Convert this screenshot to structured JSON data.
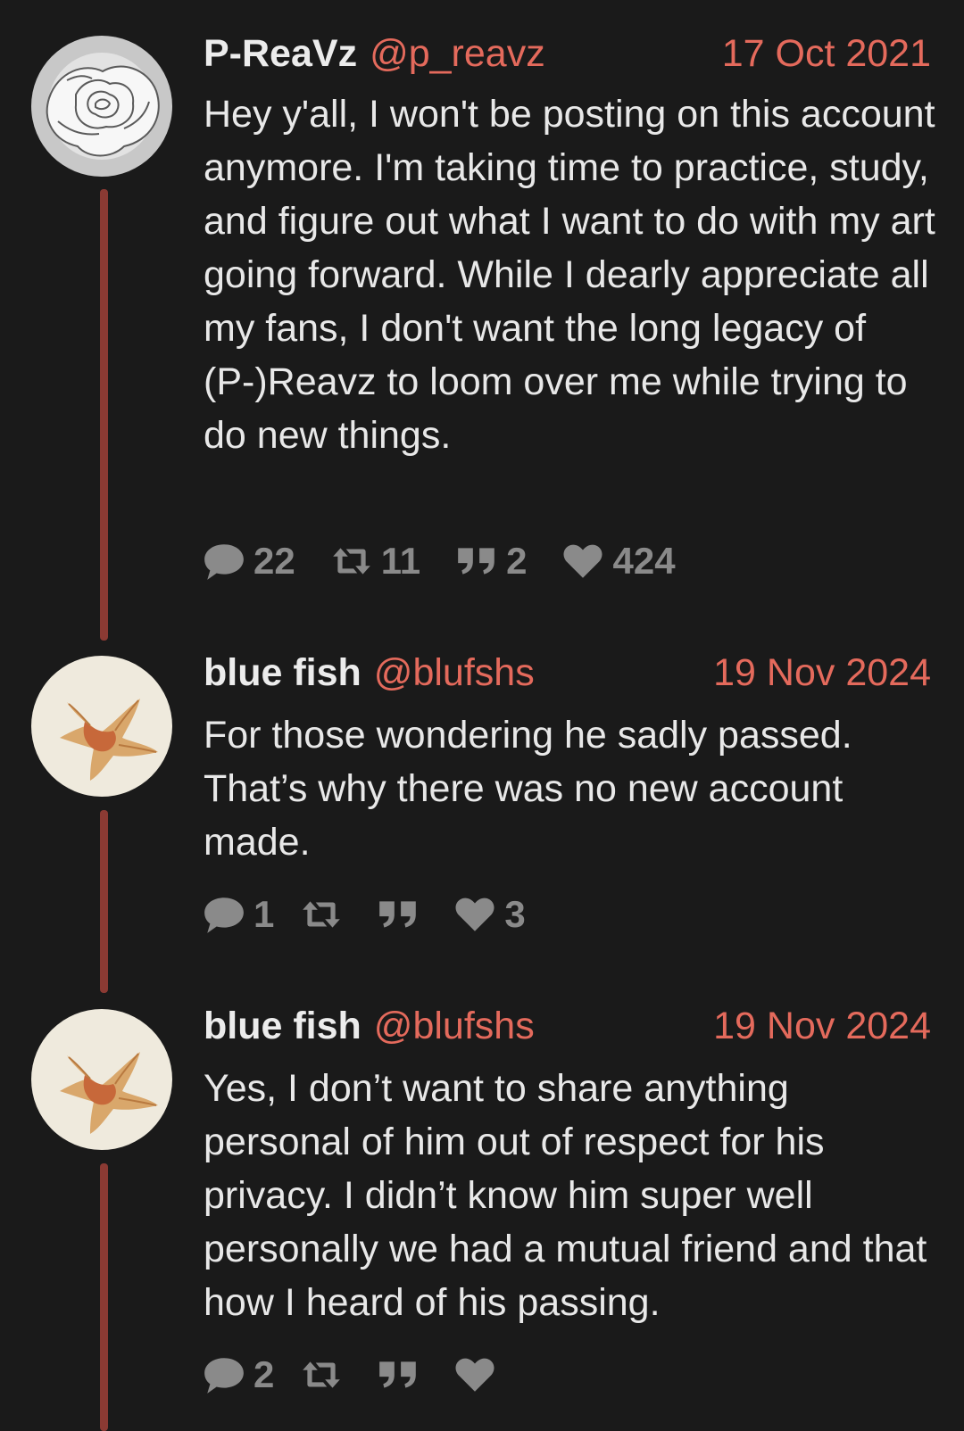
{
  "posts": [
    {
      "display_name": "P-ReaVz",
      "handle": "@p_reavz",
      "date": "17 Oct 2021",
      "text": "Hey y'all, I won't be posting on this account anymore. I'm taking time to practice, study, and figure out what I want to do with my art going forward. While I dearly appreciate all my fans, I don't want the long legacy of (P-)Reavz to loom over me while trying to do new things.",
      "avatar": "rose-avatar",
      "replies": "22",
      "retweets": "11",
      "quotes": "2",
      "likes": "424"
    },
    {
      "display_name": "blue fish",
      "handle": "@blufshs",
      "date": "19 Nov 2024",
      "text": "For those wondering he sadly passed. That’s why there was no new account made.",
      "avatar": "pastry-avatar",
      "replies": "1",
      "retweets": "",
      "quotes": "",
      "likes": "3"
    },
    {
      "display_name": "blue fish",
      "handle": "@blufshs",
      "date": "19 Nov 2024",
      "text": "Yes, I don’t want to share anything personal of him out of respect for his privacy. I didn’t know him super well personally we had a mutual friend and that how I heard of his passing.",
      "avatar": "pastry-avatar",
      "replies": "2",
      "retweets": "",
      "quotes": "",
      "likes": ""
    }
  ],
  "icons": {
    "reply": "speech-bubble-icon",
    "retweet": "retweet-icon",
    "quote": "quote-icon",
    "like": "heart-icon"
  },
  "colors": {
    "background": "#1a1a1a",
    "accent": "#e46a5c",
    "thread_line": "#8b3a33",
    "muted": "#8a8a8a"
  }
}
